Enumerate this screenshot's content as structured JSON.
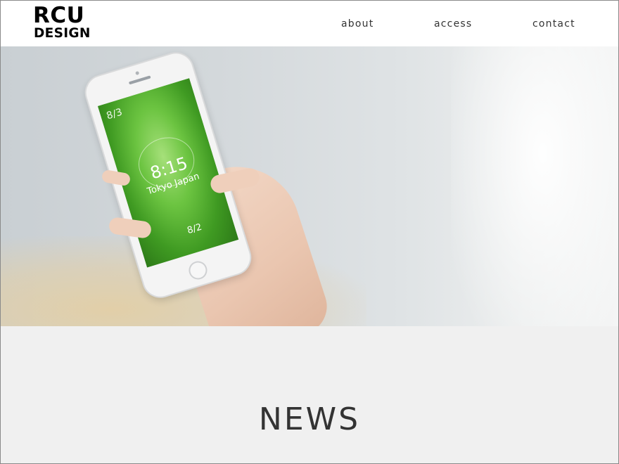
{
  "brand": {
    "logo_line1": "RCU",
    "logo_line2": "DESIGN"
  },
  "nav": {
    "items": [
      {
        "label": "about"
      },
      {
        "label": "access"
      },
      {
        "label": "contact"
      }
    ]
  },
  "hero": {
    "phone_screen": {
      "date_top": "8/3",
      "time": "8:15",
      "location": "Tokyo Japan",
      "date_bottom": "8/2"
    },
    "slider": {
      "count": 3,
      "active_index": 0
    }
  },
  "news": {
    "title": "NEWS"
  },
  "colors": {
    "accent": "#17407c",
    "section_bg": "#f0f0f0",
    "text": "#333333"
  }
}
